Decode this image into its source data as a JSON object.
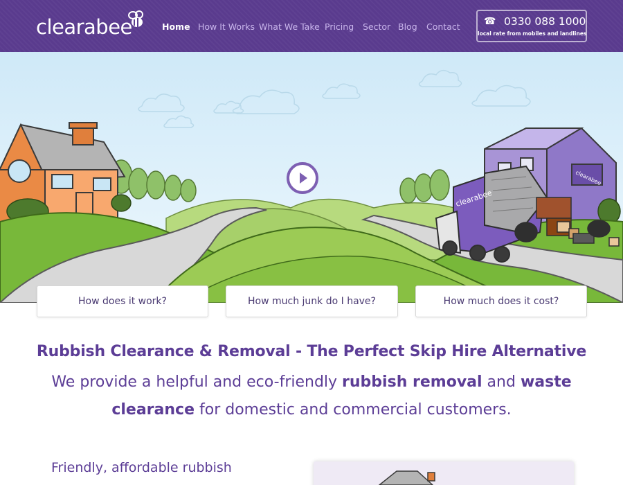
{
  "header": {
    "logo_text": "clearabee",
    "nav": [
      {
        "label": "Home",
        "active": true
      },
      {
        "label": "How It Works",
        "active": false
      },
      {
        "label": "What We Take",
        "active": false
      },
      {
        "label": "Pricing",
        "active": false
      },
      {
        "label": "Sector",
        "active": false
      },
      {
        "label": "Blog",
        "active": false
      },
      {
        "label": "Contact",
        "active": false
      }
    ],
    "phone": {
      "icon": "phone-icon",
      "number": "0330 088 1000",
      "subtext": "local rate from mobiles and landlines"
    }
  },
  "hero": {
    "play_icon": "play-icon",
    "truck_brand": "clearabee",
    "building_brand": "clearabee"
  },
  "cards": [
    {
      "label": "How does it work?"
    },
    {
      "label": "How much junk do I have?"
    },
    {
      "label": "How much does it cost?"
    }
  ],
  "intro": {
    "headline": "Rubbish Clearance & Removal - The Perfect Skip Hire Alternative",
    "sub_part1": "We provide a helpful and eco-friendly ",
    "sub_bold1": "rubbish removal",
    "sub_part2": " and ",
    "sub_bold2": "waste clearance",
    "sub_part3": " for domestic and commercial customers."
  },
  "section": {
    "heading": "Friendly, affordable rubbish"
  },
  "colors": {
    "brand_purple": "#5a3b8e",
    "text_purple": "#5c3d96",
    "nav_inactive": "#c9b6ec",
    "grass": "#78b83a"
  }
}
